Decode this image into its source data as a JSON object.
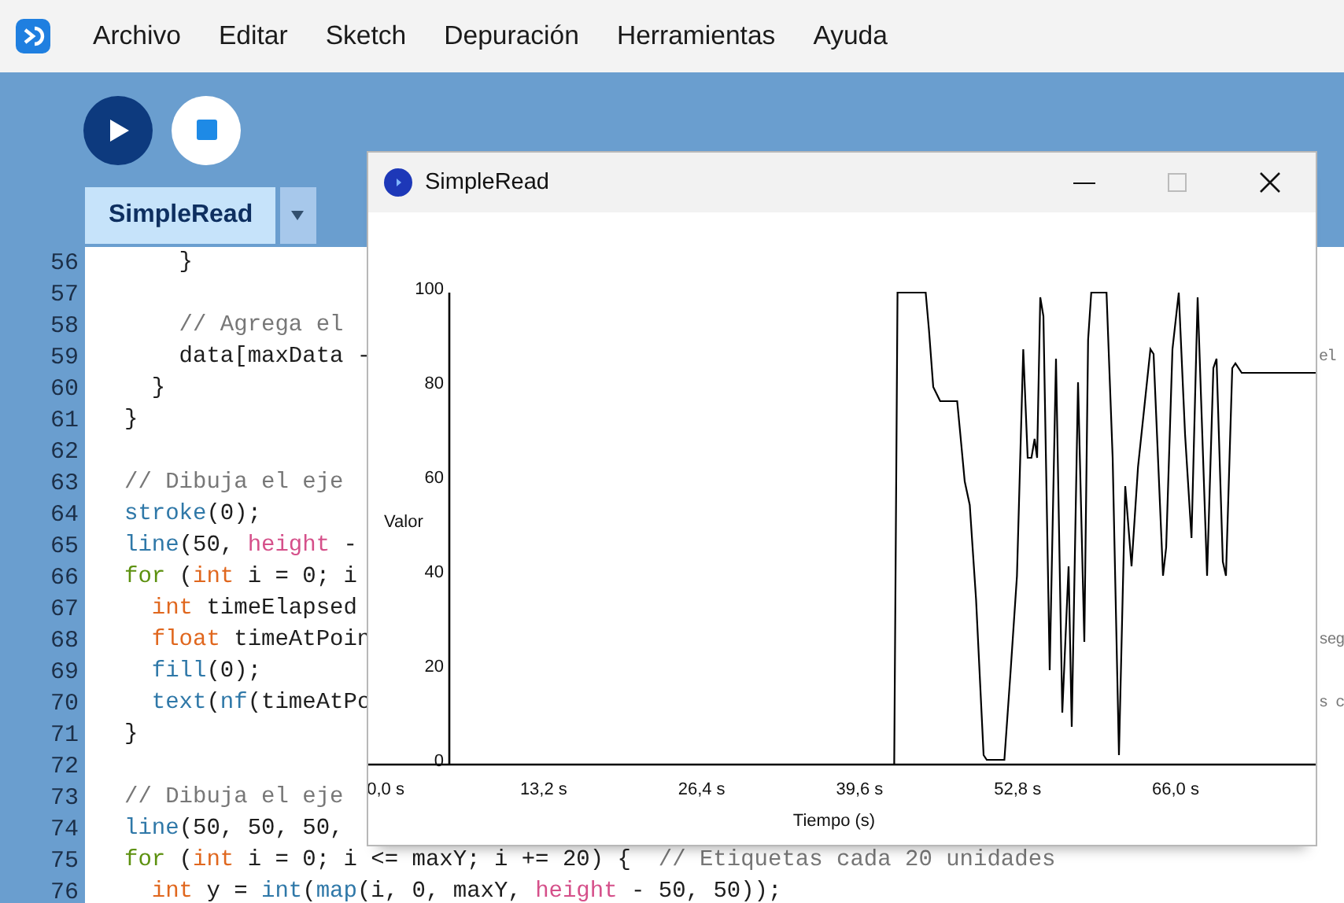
{
  "menu": {
    "items": [
      "Archivo",
      "Editar",
      "Sketch",
      "Depuración",
      "Herramientas",
      "Ayuda"
    ]
  },
  "tabs": [
    {
      "label": "SimpleRead",
      "selected": true
    }
  ],
  "editor": {
    "lines": [
      {
        "number": "56",
        "tokens": [
          {
            "kind": "plain",
            "text": "    }"
          }
        ]
      },
      {
        "number": "57"
      },
      {
        "number": "58",
        "tokens": [
          {
            "kind": "comment",
            "text": "    // Agrega el"
          }
        ]
      },
      {
        "number": "59",
        "tokens": [
          {
            "kind": "plain",
            "text": "    data[maxData -"
          }
        ],
        "tail": "el"
      },
      {
        "number": "60",
        "tokens": [
          {
            "kind": "plain",
            "text": "  }"
          }
        ]
      },
      {
        "number": "61",
        "tokens": [
          {
            "kind": "plain",
            "text": "}"
          }
        ]
      },
      {
        "number": "62"
      },
      {
        "number": "63",
        "tokens": [
          {
            "kind": "comment",
            "text": "// Dibuja el eje"
          }
        ]
      },
      {
        "number": "64",
        "tokens": [
          {
            "kind": "builtin",
            "text": "stroke"
          },
          {
            "kind": "plain",
            "text": "(0);"
          }
        ]
      },
      {
        "number": "65",
        "tokens": [
          {
            "kind": "builtin",
            "text": "line"
          },
          {
            "kind": "plain",
            "text": "(50, "
          },
          {
            "kind": "constant",
            "text": "height"
          },
          {
            "kind": "plain",
            "text": " -"
          }
        ]
      },
      {
        "number": "66",
        "tokens": [
          {
            "kind": "keyword",
            "text": "for"
          },
          {
            "kind": "plain",
            "text": " ("
          },
          {
            "kind": "type",
            "text": "int"
          },
          {
            "kind": "plain",
            "text": " i = 0; i"
          }
        ]
      },
      {
        "number": "67",
        "tokens": [
          {
            "kind": "type",
            "text": "  int"
          },
          {
            "kind": "plain",
            "text": " timeElapsed"
          }
        ]
      },
      {
        "number": "68",
        "tokens": [
          {
            "kind": "type",
            "text": "  float"
          },
          {
            "kind": "plain",
            "text": " timeAtPoin"
          }
        ],
        "tail": "seg"
      },
      {
        "number": "69",
        "tokens": [
          {
            "kind": "builtin",
            "text": "  fill"
          },
          {
            "kind": "plain",
            "text": "(0);"
          }
        ]
      },
      {
        "number": "70",
        "tokens": [
          {
            "kind": "builtin",
            "text": "  text"
          },
          {
            "kind": "plain",
            "text": "("
          },
          {
            "kind": "builtin",
            "text": "nf"
          },
          {
            "kind": "plain",
            "text": "(timeAtPo"
          }
        ],
        "tail": "s c"
      },
      {
        "number": "71",
        "tokens": [
          {
            "kind": "plain",
            "text": "}"
          }
        ]
      },
      {
        "number": "72"
      },
      {
        "number": "73",
        "tokens": [
          {
            "kind": "comment",
            "text": "// Dibuja el eje"
          }
        ]
      },
      {
        "number": "74",
        "tokens": [
          {
            "kind": "builtin",
            "text": "line"
          },
          {
            "kind": "plain",
            "text": "(50, 50, 50,"
          }
        ]
      },
      {
        "number": "75",
        "tokens": [
          {
            "kind": "keyword",
            "text": "for"
          },
          {
            "kind": "plain",
            "text": " ("
          },
          {
            "kind": "type",
            "text": "int"
          },
          {
            "kind": "plain",
            "text": " i = 0; i <= maxY; i += 20) {  "
          },
          {
            "kind": "comment",
            "text": "// Etiquetas cada 20 unidades"
          }
        ]
      },
      {
        "number": "76",
        "tokens": [
          {
            "kind": "type",
            "text": "  int"
          },
          {
            "kind": "plain",
            "text": " y = "
          },
          {
            "kind": "builtin",
            "text": "int"
          },
          {
            "kind": "plain",
            "text": "("
          },
          {
            "kind": "builtin",
            "text": "map"
          },
          {
            "kind": "plain",
            "text": "(i, 0, maxY, "
          },
          {
            "kind": "constant",
            "text": "height"
          },
          {
            "kind": "plain",
            "text": " - 50, 50));"
          }
        ]
      }
    ]
  },
  "sketch_window": {
    "title": "SimpleRead",
    "chart_data": {
      "type": "line",
      "xlabel": "Tiempo (s)",
      "ylabel": "Valor",
      "xlim": [
        -1.45,
        77.7
      ],
      "ylim": [
        0,
        100
      ],
      "xticks": [
        {
          "value": 0,
          "label": "0,0 s"
        },
        {
          "value": 13.2,
          "label": "13,2 s"
        },
        {
          "value": 26.4,
          "label": "26,4 s"
        },
        {
          "value": 39.6,
          "label": "39,6 s"
        },
        {
          "value": 52.8,
          "label": "52,8 s"
        },
        {
          "value": 66,
          "label": "66,0 s"
        }
      ],
      "yticks": [
        0,
        20,
        40,
        60,
        80,
        100
      ],
      "x": [
        5.21,
        42.49,
        42.76,
        45.12,
        45.39,
        45.75,
        46.33,
        47.75,
        48.01,
        48.38,
        48.8,
        49.33,
        49.96,
        50.22,
        51.7,
        52.22,
        52.75,
        53.27,
        53.64,
        53.96,
        54.22,
        54.43,
        54.69,
        54.96,
        55.48,
        56.01,
        56.53,
        57.06,
        57.32,
        57.85,
        58.37,
        58.69,
        58.95,
        60.22,
        60.74,
        61.27,
        61.79,
        62.32,
        62.85,
        63.9,
        64.16,
        64.95,
        65.21,
        65.74,
        66.26,
        66.79,
        67.32,
        67.84,
        68.63,
        69.16,
        69.42,
        69.94,
        70.21,
        70.73,
        71.0,
        71.52,
        77.7
      ],
      "series": [
        {
          "color": "#000000",
          "values": [
            0,
            0,
            100,
            100,
            92,
            80,
            77,
            77,
            70,
            60,
            55,
            35,
            2,
            1,
            1,
            20,
            40,
            88,
            65,
            65,
            69,
            65,
            99,
            95,
            20,
            86,
            11,
            42,
            8,
            81,
            26,
            90,
            100,
            100,
            65,
            2,
            59,
            42,
            63,
            88,
            87,
            40,
            46,
            88,
            100,
            70,
            48,
            99,
            40,
            84,
            86,
            43,
            40,
            84,
            85,
            83,
            83
          ]
        }
      ]
    }
  }
}
